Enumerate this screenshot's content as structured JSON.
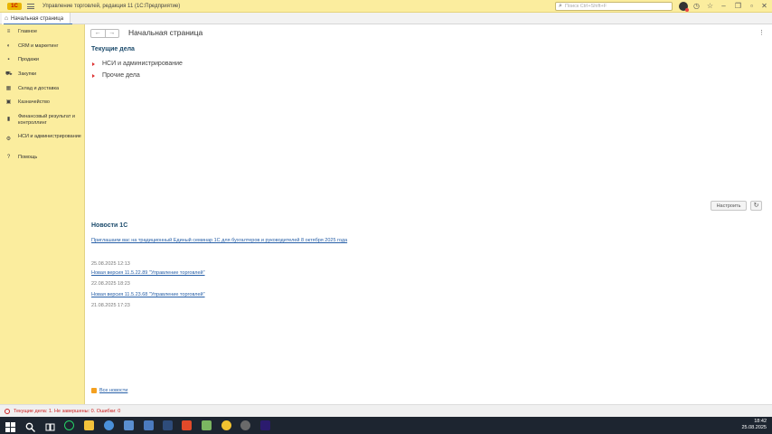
{
  "titlebar": {
    "logo_text": "1С",
    "app_title": "Управление торговлей, редакция 11  (1С:Предприятие)",
    "search_placeholder": "Поиск Ctrl+Shift+F",
    "icons": [
      "hamburger-icon",
      "search-icon",
      "history-icon",
      "star-icon",
      "minimize-icon",
      "restore-icon",
      "close-icon"
    ]
  },
  "tabs": [
    {
      "label": "Начальная страница",
      "icon": "home-icon",
      "active": true
    }
  ],
  "sidebar": {
    "items": [
      {
        "label": "Главное",
        "icon": "menu-lines-icon"
      },
      {
        "label": "CRM и маркетинг",
        "icon": "crm-icon"
      },
      {
        "label": "Продажи",
        "icon": "sales-icon"
      },
      {
        "label": "Закупки",
        "icon": "cart-icon"
      },
      {
        "label": "Склад и доставка",
        "icon": "warehouse-icon"
      },
      {
        "label": "Казначейство",
        "icon": "treasury-icon"
      },
      {
        "label": "Финансовый результат и контроллинг",
        "icon": "chart-icon"
      },
      {
        "label": "НСИ и администрирование",
        "icon": "gear-icon"
      },
      {
        "label": "Помощь",
        "icon": "help-icon"
      }
    ]
  },
  "main": {
    "nav_back": "←",
    "nav_forward": "→",
    "page_title": "Начальная страница",
    "more_icon": "⋮",
    "current_tasks": {
      "title": "Текущие дела",
      "items": [
        "НСИ и администрирование",
        "Прочие дела"
      ]
    },
    "configure_button": "Настроить",
    "refresh_icon": "↻",
    "news": {
      "title": "Новости 1С",
      "entries": [
        {
          "link": "Приглашаем вас на традиционный Единый семинар 1С для бухгалтеров и руководителей 8 октября 2025 года",
          "date": "25.08.2025 12:13"
        },
        {
          "link": "Новая версия 11.5.22.89 \"Управление торговлей\"",
          "date": "22.08.2025 18:23"
        },
        {
          "link": "Новая версия 11.5.23.68 \"Управление торговлей\"",
          "date": "21.08.2025 17:23"
        }
      ],
      "all_news": "Все новости"
    }
  },
  "statusbar": {
    "text": "Текущие дела: 1.  Не завершены: 0.  Ошибки: 0"
  },
  "taskbar": {
    "icons": [
      {
        "name": "windows-start-icon",
        "color": "#ffffff"
      },
      {
        "name": "search-icon",
        "color": "#ffffff"
      },
      {
        "name": "task-view-icon",
        "color": "#ffffff"
      },
      {
        "name": "whatsapp-icon",
        "color": "#25d366"
      },
      {
        "name": "file-explorer-icon",
        "color": "#f3c23b"
      },
      {
        "name": "network-globe-icon",
        "color": "#4a90d9"
      },
      {
        "name": "remote-desktop-icon",
        "color": "#5a8fd0"
      },
      {
        "name": "control-panel-icon",
        "color": "#4b7bbf"
      },
      {
        "name": "1c-app-icon",
        "color": "#e24a2a"
      },
      {
        "name": "calculator-icon",
        "color": "#7bb661"
      },
      {
        "name": "chrome-icon",
        "color": "#f2c230"
      },
      {
        "name": "photo-viewer-icon",
        "color": "#6a6a6a"
      },
      {
        "name": "premiere-icon",
        "color": "#2b1b6e"
      }
    ],
    "time": "18:42",
    "date": "25.08.2025"
  },
  "colors": {
    "sidebar_bg": "#fbed9e",
    "section_title": "#1b4a6b",
    "link": "#2860a8",
    "accent": "#3b6fb6"
  }
}
